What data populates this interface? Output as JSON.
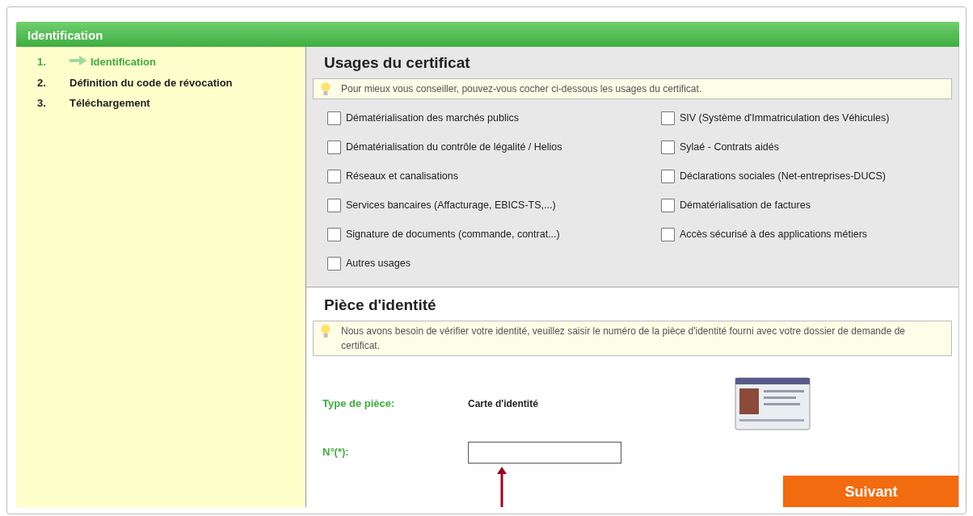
{
  "header": {
    "title": "Identification"
  },
  "steps": [
    {
      "number": "1.",
      "label": "Identification",
      "selected": true
    },
    {
      "number": "2.",
      "label": "Définition du code de révocation",
      "selected": false
    },
    {
      "number": "3.",
      "label": "Téléchargement",
      "selected": false
    }
  ],
  "usages": {
    "title": "Usages du certificat",
    "hint": "Pour mieux vous conseiller, pouvez-vous cocher ci-dessous les usages du certificat.",
    "left": [
      {
        "label": "Dématérialisation des marchés publics",
        "checked": false
      },
      {
        "label": "Dématérialisation du contrôle de légalité / Helios",
        "checked": false
      },
      {
        "label": "Réseaux et canalisations",
        "checked": false
      },
      {
        "label": "Services bancaires (Affacturage, EBICS-TS,...)",
        "checked": false
      },
      {
        "label": "Signature de documents (commande, contrat...)",
        "checked": false
      },
      {
        "label": "Autres usages",
        "checked": false
      }
    ],
    "right": [
      {
        "label": "SIV (Système d'Immatriculation des Véhicules)",
        "checked": false
      },
      {
        "label": "Sylaé - Contrats aidés",
        "checked": false
      },
      {
        "label": "Déclarations sociales (Net-entreprises-DUCS)",
        "checked": false
      },
      {
        "label": "Dématérialisation de factures",
        "checked": false
      },
      {
        "label": "Accès sécurisé à des applications métiers",
        "checked": false
      }
    ]
  },
  "identity": {
    "title": "Pièce d'identité",
    "hint": "Nous avons besoin de vérifier votre identité, veuillez saisir le numéro de la pièce d'identité fourni avec votre dossier de demande de certificat.",
    "type_label": "Type de pièce:",
    "type_value": "Carte d'identité",
    "number_label": "N°(*):"
  },
  "next_button": "Suivant"
}
